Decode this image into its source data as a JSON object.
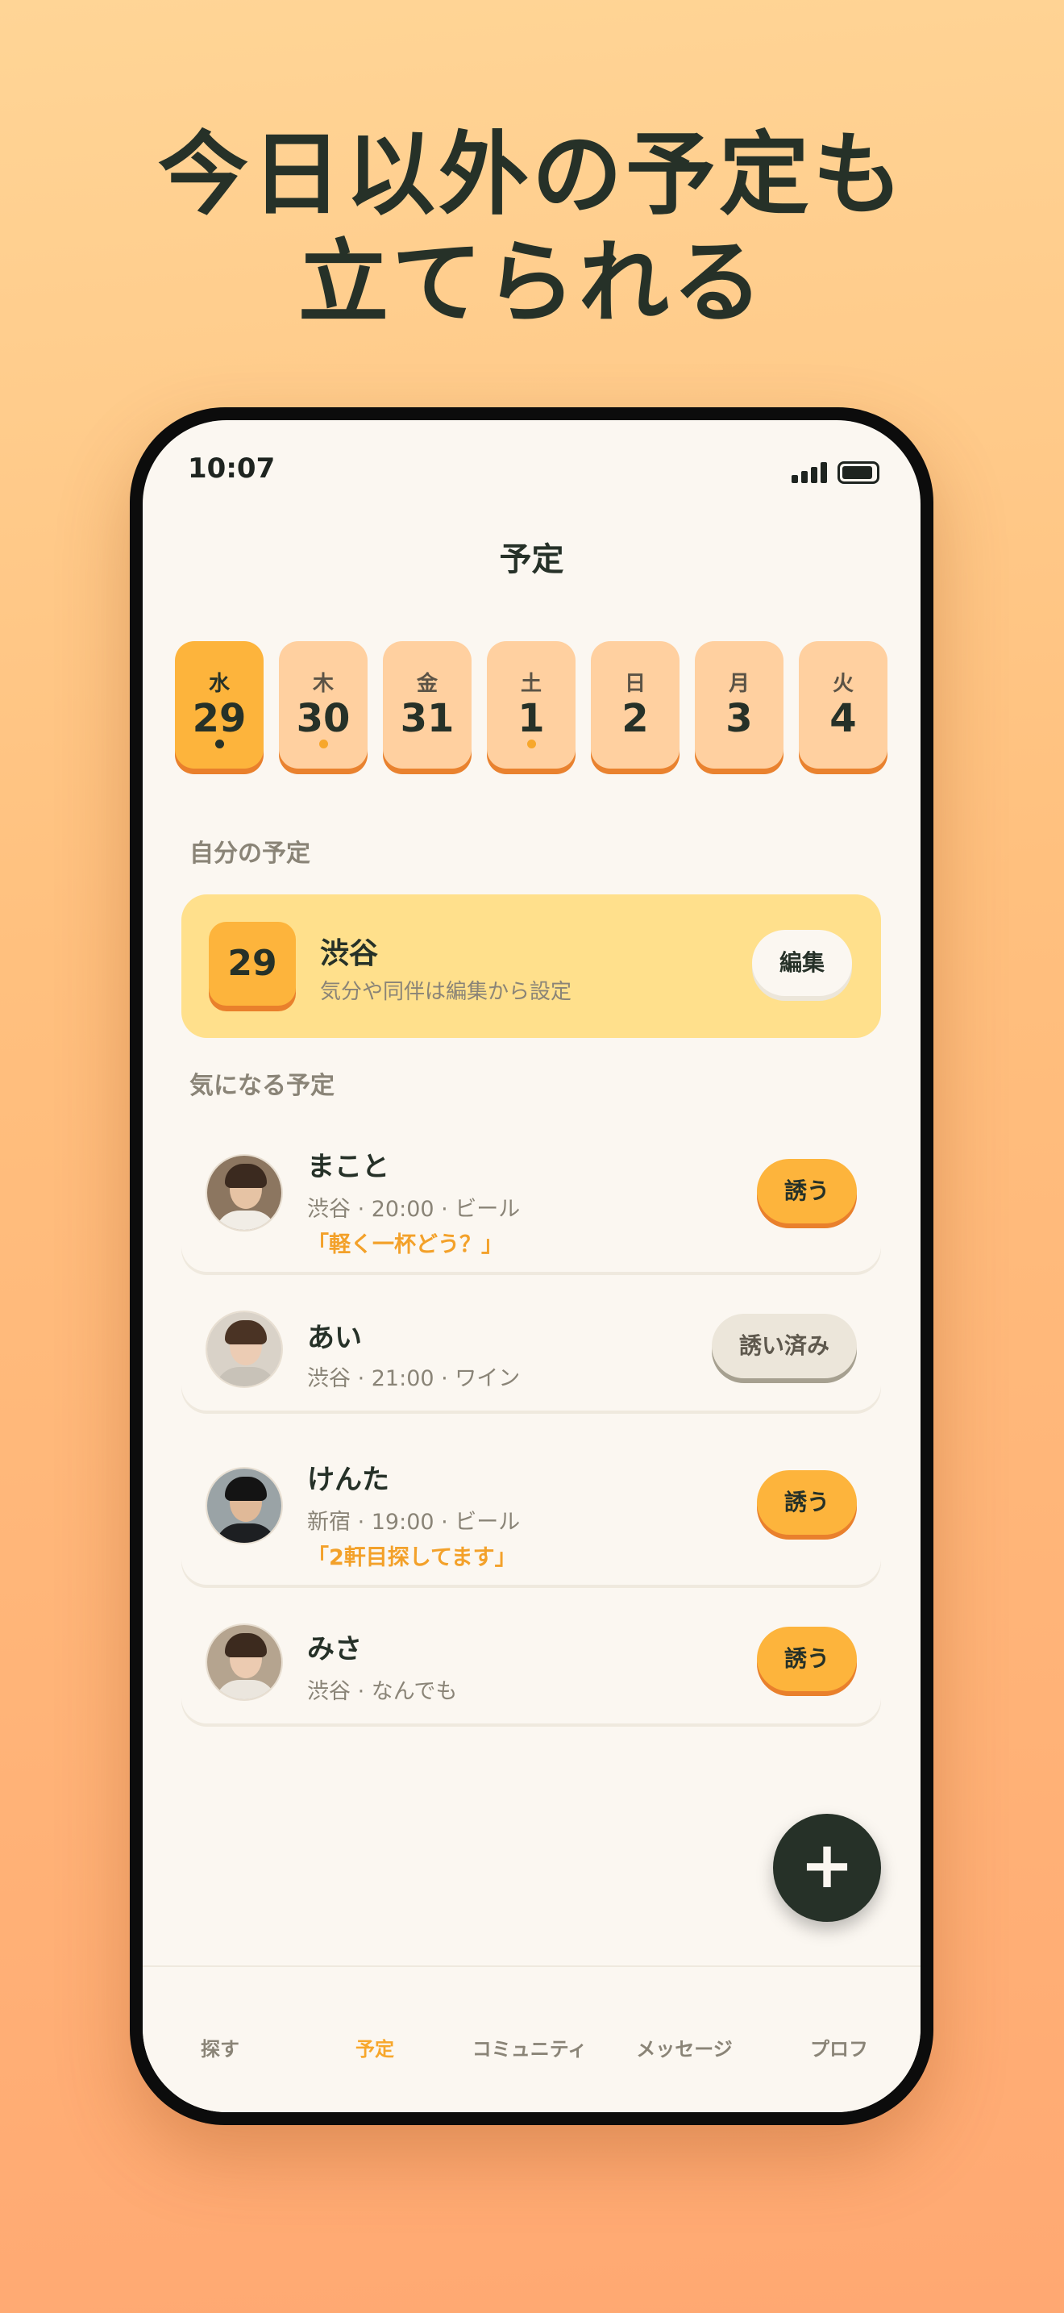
{
  "headline": {
    "line1": "今日以外の予定も",
    "line2": "立てられる"
  },
  "status": {
    "time": "10:07"
  },
  "screen": {
    "title": "予定"
  },
  "days": [
    {
      "dow": "水",
      "num": "29",
      "dot": true,
      "active": true
    },
    {
      "dow": "木",
      "num": "30",
      "dot": true,
      "active": false
    },
    {
      "dow": "金",
      "num": "31",
      "dot": false,
      "active": false
    },
    {
      "dow": "土",
      "num": "1",
      "dot": true,
      "active": false
    },
    {
      "dow": "日",
      "num": "2",
      "dot": false,
      "active": false
    },
    {
      "dow": "月",
      "num": "3",
      "dot": false,
      "active": false
    },
    {
      "dow": "火",
      "num": "4",
      "dot": false,
      "active": false
    }
  ],
  "my_plan": {
    "section": "自分の予定",
    "date": "29",
    "place": "渋谷",
    "sub": "気分や同伴は編集から設定",
    "edit_label": "編集"
  },
  "interested": {
    "section": "気になる予定",
    "people": [
      {
        "name": "まこと",
        "meta": "渋谷 · 20:00 · ビール",
        "quote": "「軽く一杯どう？」",
        "button": "誘う",
        "invited": false
      },
      {
        "name": "あい",
        "meta": "渋谷 · 21:00 · ワイン",
        "quote": "",
        "button": "誘い済み",
        "invited": true
      },
      {
        "name": "けんた",
        "meta": "新宿 · 19:00 · ビール",
        "quote": "「2軒目探してます」",
        "button": "誘う",
        "invited": false
      },
      {
        "name": "みさ",
        "meta": "渋谷 · なんでも",
        "quote": "",
        "button": "誘う",
        "invited": false
      }
    ]
  },
  "fab": {
    "icon": "plus-icon",
    "glyph": "+"
  },
  "tabs": [
    {
      "label": "探す",
      "active": false
    },
    {
      "label": "予定",
      "active": true
    },
    {
      "label": "コミュニティ",
      "active": false
    },
    {
      "label": "メッセージ",
      "active": false
    },
    {
      "label": "プロフ",
      "active": false
    }
  ],
  "colors": {
    "accent": "#fdb43c",
    "accent_shadow": "#e9802c",
    "dark": "#263128",
    "card_yellow": "#ffe08c",
    "day_peach": "#ffd0a0",
    "quote": "#f3a12a"
  }
}
